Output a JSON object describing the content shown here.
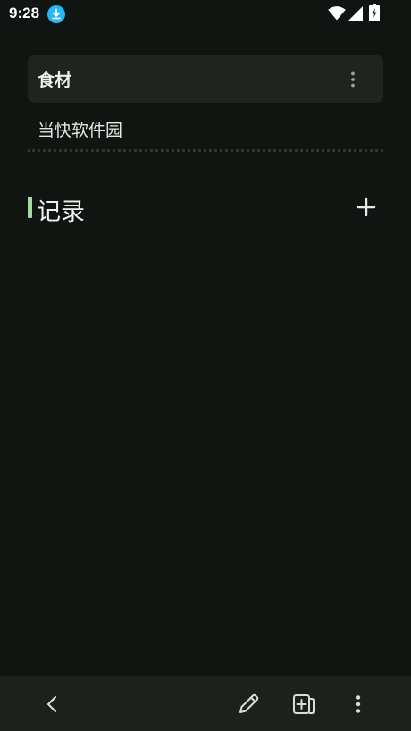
{
  "status_bar": {
    "time": "9:28",
    "icons": [
      "download-icon",
      "wifi-icon",
      "cellular-signal-icon",
      "battery-charging-icon"
    ]
  },
  "card": {
    "title": "食材",
    "items": [
      "当快软件园"
    ],
    "menu_icon": "more-vertical-icon"
  },
  "section": {
    "title": "记录",
    "accent_color": "#a8d8a5",
    "add_icon": "plus-icon"
  },
  "bottom_bar": {
    "icons": [
      "back-chevron-icon",
      "pencil-icon",
      "add-page-icon",
      "more-vertical-icon"
    ]
  }
}
